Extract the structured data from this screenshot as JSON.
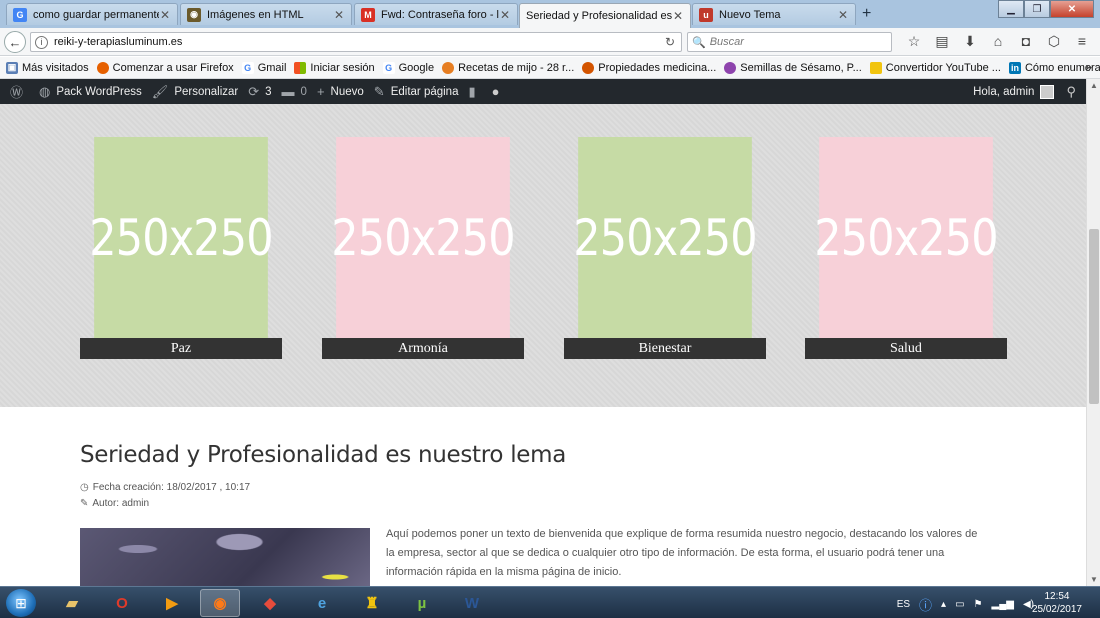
{
  "browser": {
    "tabs": [
      {
        "title": "como guardar permanente...",
        "icon": "google-icon",
        "color": "#4285f4",
        "glyph": "G"
      },
      {
        "title": "Imágenes en HTML",
        "icon": "site-icon",
        "color": "#6b5a2b",
        "glyph": "◉"
      },
      {
        "title": "Fwd: Contraseña foro - lu...",
        "icon": "gmail-icon",
        "color": "#d93025",
        "glyph": "M"
      },
      {
        "title": "Seriedad y Profesionalidad es n...",
        "icon": "none",
        "color": "#f5f6f7",
        "glyph": ""
      },
      {
        "title": "Nuevo Tema",
        "icon": "foro-icon",
        "color": "#c0392b",
        "glyph": "u"
      }
    ],
    "new_tab": "+",
    "url": "reiki-y-terapiasluminum.es",
    "search_placeholder": "Buscar",
    "bookmarks": [
      {
        "label": "Más visitados",
        "icon": "most-visited-icon",
        "color": "#5b7fb5"
      },
      {
        "label": "Comenzar a usar Firefox",
        "icon": "firefox-icon",
        "color": "#e66000"
      },
      {
        "label": "Gmail",
        "icon": "google-icon",
        "color": "#4285f4"
      },
      {
        "label": "Iniciar sesión",
        "icon": "microsoft-icon",
        "color": "#00a4ef"
      },
      {
        "label": "Google",
        "icon": "google-icon",
        "color": "#4285f4"
      },
      {
        "label": "Recetas de mijo - 28 r...",
        "icon": "recipe-icon",
        "color": "#e67e22"
      },
      {
        "label": "Propiedades medicina...",
        "icon": "flower-icon",
        "color": "#d35400"
      },
      {
        "label": "Semillas de Sésamo, P...",
        "icon": "seed-icon",
        "color": "#8e44ad"
      },
      {
        "label": "Convertidor YouTube ...",
        "icon": "folder-icon",
        "color": "#f1c40f"
      },
      {
        "label": "Cómo enumerar pági...",
        "icon": "linkedin-icon",
        "color": "#0077b5"
      }
    ]
  },
  "adminbar": {
    "site": "Pack WordPress",
    "customize": "Personalizar",
    "updates": "3",
    "comments": "0",
    "new": "Nuevo",
    "edit": "Editar página",
    "greeting": "Hola, admin"
  },
  "hero": {
    "cards": [
      {
        "placeholder": "250x250",
        "caption": "Paz",
        "color": "#c6dba5"
      },
      {
        "placeholder": "250x250",
        "caption": "Armonía",
        "color": "#f7d0d8"
      },
      {
        "placeholder": "250x250",
        "caption": "Bienestar",
        "color": "#c6dba5"
      },
      {
        "placeholder": "250x250",
        "caption": "Salud",
        "color": "#f7d0d8"
      }
    ]
  },
  "post": {
    "title": "Seriedad y Profesionalidad es nuestro lema",
    "date_label": "Fecha creación: 18/02/2017 , 10:17",
    "author_label": "Autor: admin",
    "excerpt": "Aquí podemos poner un texto de bienvenida que explique de forma resumida nuestro negocio, destacando los valores de la empresa, sector al que se dedica o cualquier otro tipo de información. De esta forma, el usuario podrá tener una información rápida en la misma página de inicio."
  },
  "taskbar": {
    "lang": "ES",
    "time": "12:54",
    "date": "25/02/2017"
  }
}
